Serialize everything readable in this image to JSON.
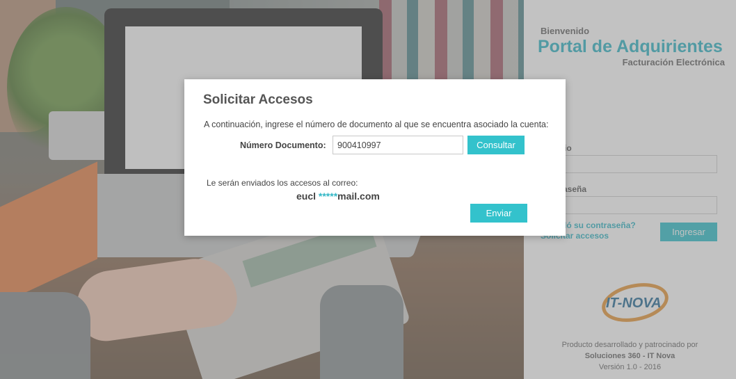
{
  "login": {
    "welcome": "Bienvenido",
    "title": "Portal de Adquirientes",
    "subtitle": "Facturación Electrónica",
    "user_label": "Usuario",
    "password_label": "Contraseña",
    "forgot_link": "¿Olvidó su contraseña?",
    "request_link": "Solicitar accesos",
    "login_button": "Ingresar",
    "logo_text": "IT-NOVA",
    "footer_line1": "Producto desarrollado y patrocinado por",
    "footer_line2": "Soluciones 360 - IT Nova",
    "footer_line3": "Versión 1.0 - 2016"
  },
  "modal": {
    "title": "Solicitar Accesos",
    "description": "A continuación, ingrese el número de documento al que se encuentra asociado la cuenta:",
    "document_label": "Número Documento:",
    "document_value": "900410997",
    "consult_button": "Consultar",
    "email_label": "Le serán enviados los accesos al correo:",
    "email_prefix": "eucl ",
    "email_mask": "*****",
    "email_suffix": "mail.com",
    "send_button": "Enviar"
  },
  "colors": {
    "accent": "#33c2cc",
    "title_accent": "#33b7c6"
  }
}
